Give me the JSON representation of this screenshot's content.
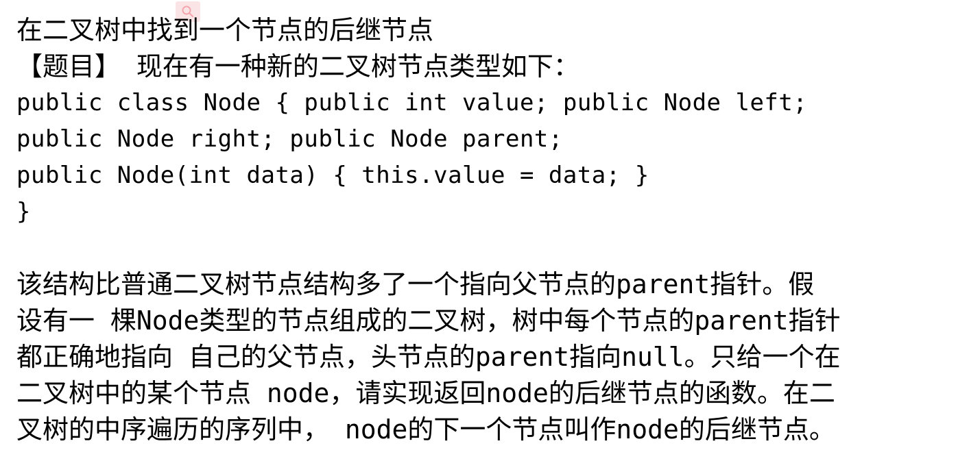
{
  "title": "在二叉树中找到一个节点的后继节点",
  "problem_line": "【题目】 现在有一种新的二叉树节点类型如下：",
  "code_lines": [
    "public class Node { public int value; public Node left;",
    "public Node right; public Node parent;",
    "public Node(int data) { this.value = data; }",
    "}"
  ],
  "paragraph_lines": [
    "该结构比普通二叉树节点结构多了一个指向父节点的parent指针。假",
    "设有一 棵Node类型的节点组成的二叉树，树中每个节点的parent指针",
    "都正确地指向 自己的父节点，头节点的parent指向null。只给一个在",
    "二叉树中的某个节点 node，请实现返回node的后继节点的函数。在二",
    "叉树的中序遍历的序列中， node的下一个节点叫作node的后继节点。"
  ],
  "icons": {
    "search_badge": "search-icon",
    "badge_color": "#fbe4e6",
    "icon_color": "#f4a6ae"
  }
}
